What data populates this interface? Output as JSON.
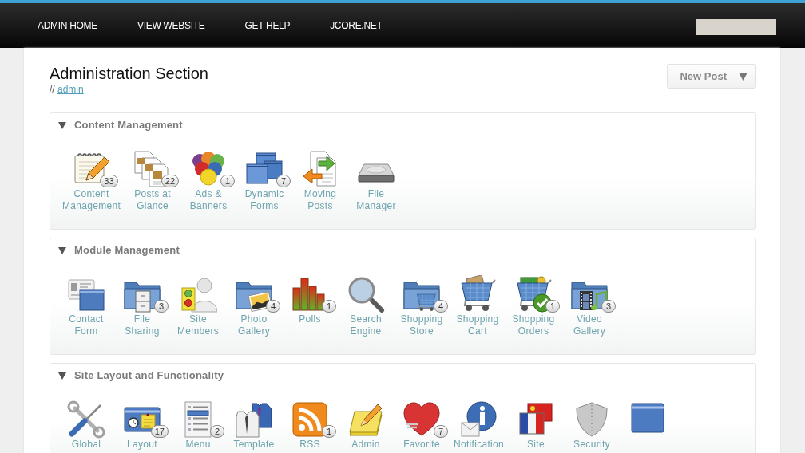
{
  "nav": {
    "links": [
      "ADMIN HOME",
      "VIEW WEBSITE",
      "GET HELP",
      "JCORE.NET"
    ]
  },
  "header": {
    "title": "Administration Section",
    "breadcrumb": {
      "separator": "//",
      "link": "admin"
    },
    "new_post_button": "New Post"
  },
  "sections": [
    {
      "title": "Content Management",
      "expanded": true,
      "items": [
        {
          "kind": "shortcut",
          "label": "Content\nManagement",
          "count": "33"
        },
        {
          "kind": "shortcut",
          "label": "Posts at\nGlance",
          "count": "22"
        },
        {
          "kind": "shortcut",
          "label": "Ads &\nBanners",
          "count": "1"
        },
        {
          "kind": "shortcut",
          "label": "Dynamic\nForms",
          "count": "7"
        },
        {
          "kind": "shortcut",
          "label": "Moving\nPosts"
        },
        {
          "kind": "shortcut",
          "label": "File\nManager"
        }
      ]
    },
    {
      "title": "Module Management",
      "expanded": true,
      "items": [
        {
          "kind": "shortcut",
          "label": "Contact\nForm"
        },
        {
          "kind": "shortcut",
          "label": "File\nSharing",
          "count": "3"
        },
        {
          "kind": "shortcut",
          "label": "Site\nMembers"
        },
        {
          "kind": "shortcut",
          "label": "Photo\nGallery",
          "count": "4"
        },
        {
          "kind": "shortcut",
          "label": "Polls",
          "count": "1"
        },
        {
          "kind": "shortcut",
          "label": "Search\nEngine"
        },
        {
          "kind": "shortcut",
          "label": "Shopping\nStore",
          "count": "4"
        },
        {
          "kind": "shortcut",
          "label": "Shopping\nCart"
        },
        {
          "kind": "shortcut",
          "label": "Shopping\nOrders",
          "count": "1"
        },
        {
          "kind": "shortcut",
          "label": "Video\nGallery",
          "count": "3"
        }
      ]
    },
    {
      "title": "Site Layout and Functionality",
      "expanded": true,
      "items": [
        {
          "kind": "shortcut",
          "label": "Global"
        },
        {
          "kind": "shortcut",
          "label": "Layout",
          "count": "17"
        },
        {
          "kind": "shortcut",
          "label": "Menu",
          "count": "2"
        },
        {
          "kind": "shortcut",
          "label": "Template"
        },
        {
          "kind": "shortcut",
          "label": "RSS",
          "count": "1"
        },
        {
          "kind": "shortcut",
          "label": "Admin"
        },
        {
          "kind": "shortcut",
          "label": "Favorite",
          "count": "7"
        },
        {
          "kind": "shortcut",
          "label": "Notification"
        },
        {
          "kind": "shortcut",
          "label": "Site"
        },
        {
          "kind": "shortcut",
          "label": "Security"
        },
        {
          "kind": "icon"
        }
      ]
    }
  ]
}
